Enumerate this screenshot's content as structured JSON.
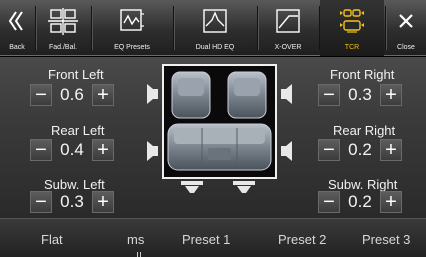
{
  "toolbar": {
    "back": "Back",
    "fad_bal": "Fad./Bal.",
    "eq_presets": "EQ Presets",
    "dual_hd_eq": "Dual HD EQ",
    "xover": "X-OVER",
    "tcr": "TCR",
    "close": "Close"
  },
  "channels": {
    "front_left": {
      "label": "Front Left",
      "value": "0.6"
    },
    "front_right": {
      "label": "Front Right",
      "value": "0.3"
    },
    "rear_left": {
      "label": "Rear Left",
      "value": "0.4"
    },
    "rear_right": {
      "label": "Rear Right",
      "value": "0.2"
    },
    "subw_left": {
      "label": "Subw. Left",
      "value": "0.3"
    },
    "subw_right": {
      "label": "Subw. Right",
      "value": "0.2"
    }
  },
  "buttons": {
    "minus": "−",
    "plus": "+"
  },
  "presets": {
    "flat": "Flat",
    "ms": "ms",
    "preset1": "Preset 1",
    "preset2": "Preset 2",
    "preset3": "Preset 3"
  },
  "colors": {
    "active_tab": "#f3c21a"
  },
  "icons": {
    "back": "back-chevron-icon",
    "fad_bal": "fader-balance-icon",
    "eq_presets": "eq-presets-icon",
    "dual_hd_eq": "dual-hd-eq-icon",
    "xover": "crossover-icon",
    "tcr": "time-correction-icon",
    "close": "close-icon"
  }
}
